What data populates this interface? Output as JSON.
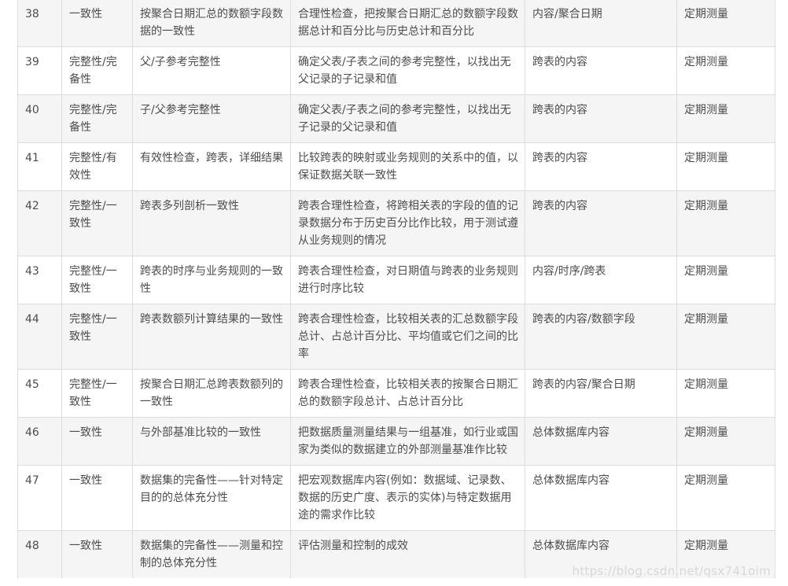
{
  "rows": [
    {
      "no": "38",
      "dim": "一致性",
      "name": "按聚合日期汇总的数额字段数据的一致性",
      "desc": "合理性检查，把按聚合日期汇总的数额字段数据总计和百分比与历史总计和百分比",
      "obj": "内容/聚合日期",
      "freq": "定期测量"
    },
    {
      "no": "39",
      "dim": "完整性/完备性",
      "name": "父/子参考完整性",
      "desc": "确定父表/子表之间的参考完整性，以找出无父记录的子记录和值",
      "obj": "跨表的内容",
      "freq": "定期测量"
    },
    {
      "no": "40",
      "dim": "完整性/完备性",
      "name": "子/父参考完整性",
      "desc": "确定父表/子表之间的参考完整性，以找出无子记录的父记录和值",
      "obj": "跨表的内容",
      "freq": "定期测量"
    },
    {
      "no": "41",
      "dim": "完整性/有效性",
      "name": "有效性检查，跨表，详细结果",
      "desc": "比较跨表的映射或业务规则的关系中的值，以保证数据关联一致性",
      "obj": "跨表的内容",
      "freq": "定期测量"
    },
    {
      "no": "42",
      "dim": "完整性/一致性",
      "name": "跨表多列剖析一致性",
      "desc": "跨表合理性检查，将跨相关表的字段的值的记录数据分布于历史百分比作比较，用于测试遵从业务规则的情况",
      "obj": "跨表的内容",
      "freq": "定期测量"
    },
    {
      "no": "43",
      "dim": "完整性/一致性",
      "name": "跨表的时序与业务规则的一致性",
      "desc": "跨表合理性检查，对日期值与跨表的业务规则进行时序比较",
      "obj": "内容/时序/跨表",
      "freq": "定期测量"
    },
    {
      "no": "44",
      "dim": "完整性/一致性",
      "name": "跨表数额列计算结果的一致性",
      "desc": "跨表合理性检查，比较相关表的汇总数额字段总计、占总计百分比、平均值或它们之间的比率",
      "obj": "跨表的内容/数额字段",
      "freq": "定期测量"
    },
    {
      "no": "45",
      "dim": "完整性/一致性",
      "name": "按聚合日期汇总跨表数额列的一致性",
      "desc": "跨表合理性检查，比较相关表的按聚合日期汇总的数额字段总计、占总计百分比",
      "obj": "跨表的内容/聚合日期",
      "freq": "定期测量"
    },
    {
      "no": "46",
      "dim": "一致性",
      "name": "与外部基准比较的一致性",
      "desc": "把数据质量测量结果与一组基准，如行业或国家为类似的数据建立的外部测量基准作比较",
      "obj": "总体数据库内容",
      "freq": "定期测量"
    },
    {
      "no": "47",
      "dim": "一致性",
      "name": "数据集的完备性——针对特定目的的总体充分性",
      "desc": "把宏观数据库内容(例如：数据域、记录数、数据的历史广度、表示的实体)与特定数据用途的需求作比较",
      "obj": "总体数据库内容",
      "freq": "定期测量"
    },
    {
      "no": "48",
      "dim": "一致性",
      "name": "数据集的完备性——测量和控制的总体充分性",
      "desc": "评估测量和控制的成效",
      "obj": "总体数据库内容",
      "freq": "定期测量"
    }
  ],
  "watermark": "https://blog.csdn.net/qsx741oim"
}
